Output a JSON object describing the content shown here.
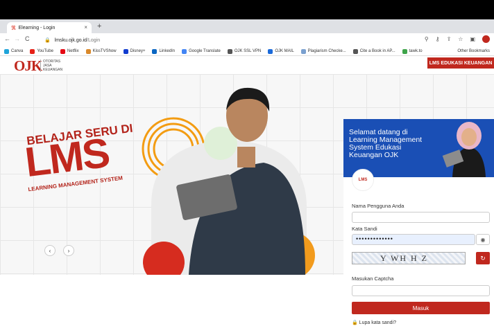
{
  "browser": {
    "tab_title": "Elearning - Login",
    "tab_close": "×",
    "new_tab": "+",
    "url_host": "lmsku.ojk.go.id",
    "url_path": "/Login",
    "bookmarks": [
      {
        "label": "Canva",
        "color": "#1fa4d9"
      },
      {
        "label": "YouTube",
        "color": "#e62117"
      },
      {
        "label": "Netflix",
        "color": "#e50914"
      },
      {
        "label": "KissTVShow",
        "color": "#d9892b"
      },
      {
        "label": "Disney+",
        "color": "#113ccf"
      },
      {
        "label": "LinkedIn",
        "color": "#0a66c2"
      },
      {
        "label": "Google Translate",
        "color": "#4285f4"
      },
      {
        "label": "OJK SSL VPN",
        "color": "#555555"
      },
      {
        "label": "OJK MAIL",
        "color": "#1b6ad9"
      },
      {
        "label": "Plagiarism Checke...",
        "color": "#7aa0cf"
      },
      {
        "label": "Cite a Book in AP...",
        "color": "#555555"
      },
      {
        "label": "tawk.to",
        "color": "#3ea44a"
      }
    ],
    "other_bookmarks": "Other Bookmarks"
  },
  "site": {
    "logo_text": "OJK",
    "logo_sub_1": "OTORITAS",
    "logo_sub_2": "JASA",
    "logo_sub_3": "KEUANGAN",
    "lms_button": "LMS EDUKASI KEUANGAN"
  },
  "hero": {
    "heading": "BELAJAR SERU DI",
    "big": "LMS",
    "sub": "LEARNING MANAGEMENT SYSTEM"
  },
  "login": {
    "welcome_1": "Selamat datang di",
    "welcome_2": "Learning Management",
    "welcome_3": "System Edukasi",
    "welcome_4": "Keuangan OJK",
    "username_label": "Nama Pengguna Anda",
    "username_value": "",
    "password_label": "Kata Sandi",
    "password_value": "•••••••••••••",
    "captcha_text": "Y WH H Z",
    "captcha_label": "Masukan Captcha",
    "captcha_value": "",
    "submit": "Masuk",
    "forgot": "Lupa kata sandi?"
  },
  "colors": {
    "brand": "#c0281e",
    "banner": "#1a4fb5"
  }
}
